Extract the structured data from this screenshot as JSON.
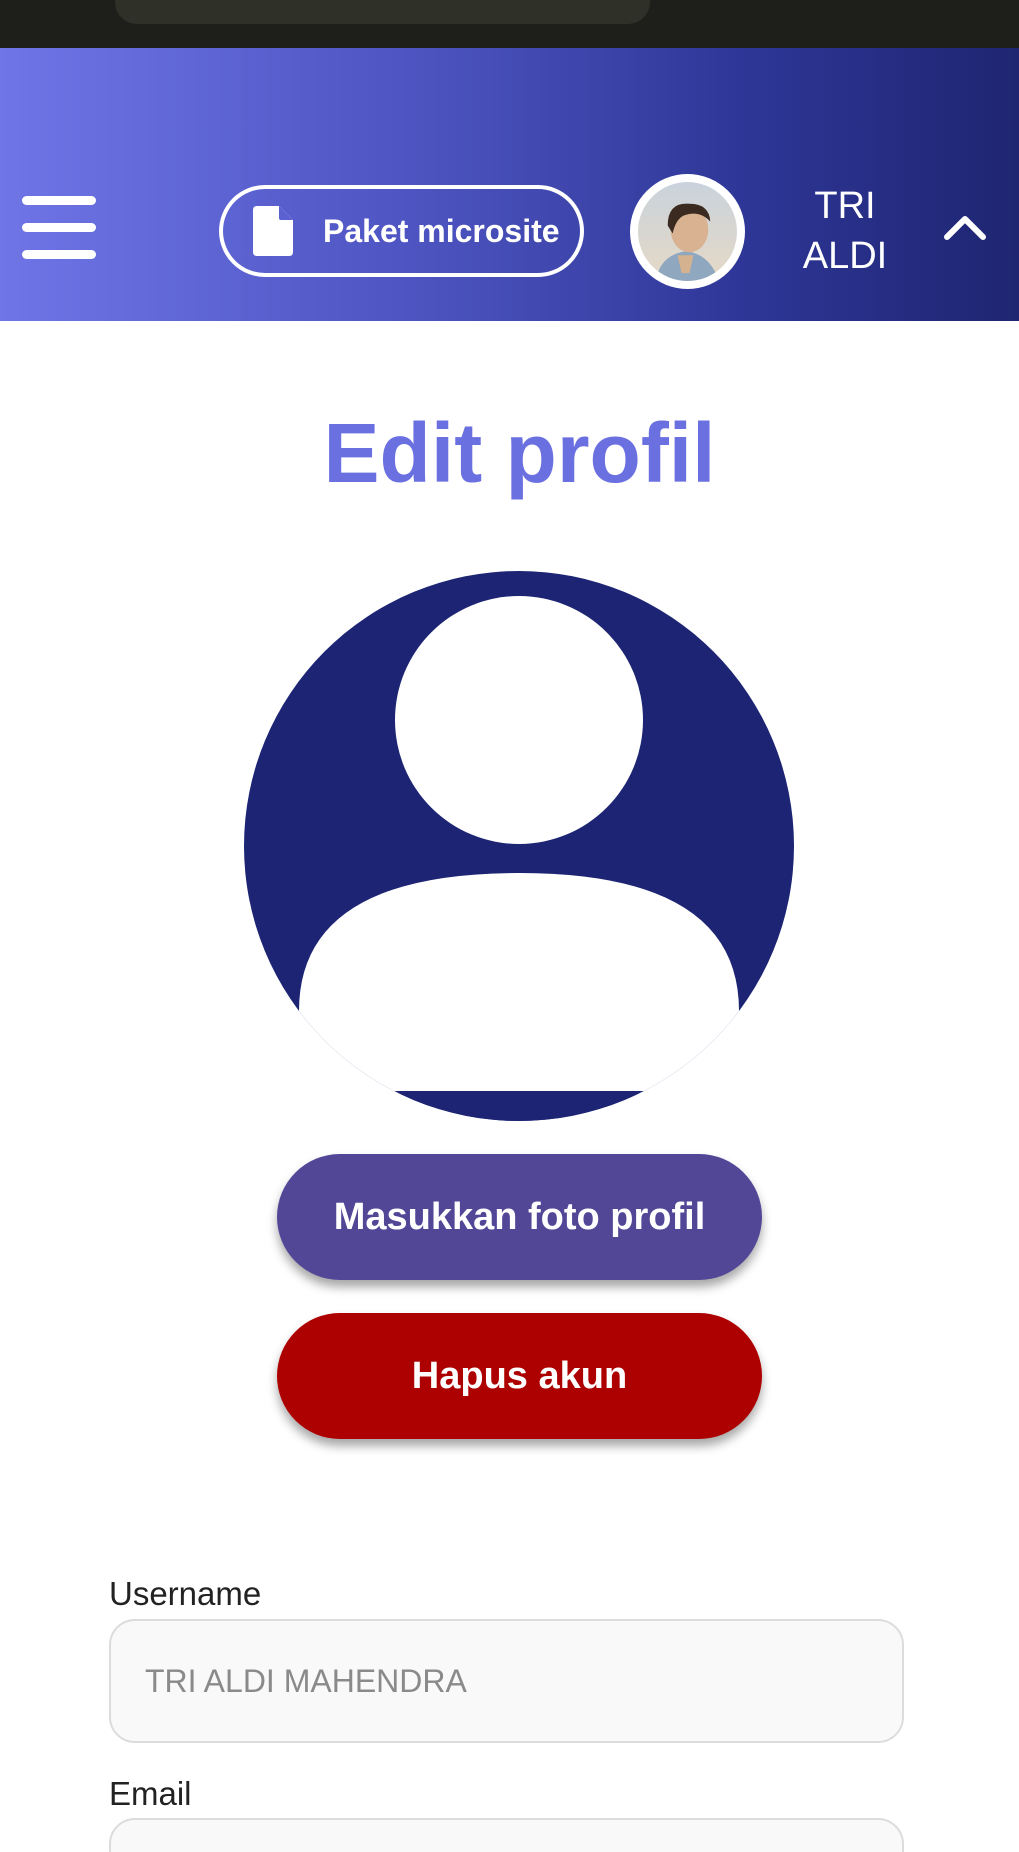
{
  "header": {
    "paket_label": "Paket microsite",
    "user_first_name": "TRI",
    "user_last_name": "ALDI"
  },
  "main": {
    "title": "Edit profil",
    "upload_photo_label": "Masukkan foto profil",
    "delete_account_label": "Hapus akun"
  },
  "form": {
    "username_label": "Username",
    "username_value": "TRI ALDI MAHENDRA",
    "email_label": "Email",
    "email_value": ""
  },
  "colors": {
    "header_gradient_start": "#6f75e6",
    "header_gradient_end": "#1f2571",
    "title": "#6b70e0",
    "avatar_background": "#1c2473",
    "upload_button": "#524797",
    "delete_button": "#ad0000"
  },
  "icons": {
    "menu": "hamburger-icon",
    "paket": "document-icon",
    "dropdown": "chevron-up-icon",
    "profile_placeholder": "user-silhouette-icon"
  }
}
